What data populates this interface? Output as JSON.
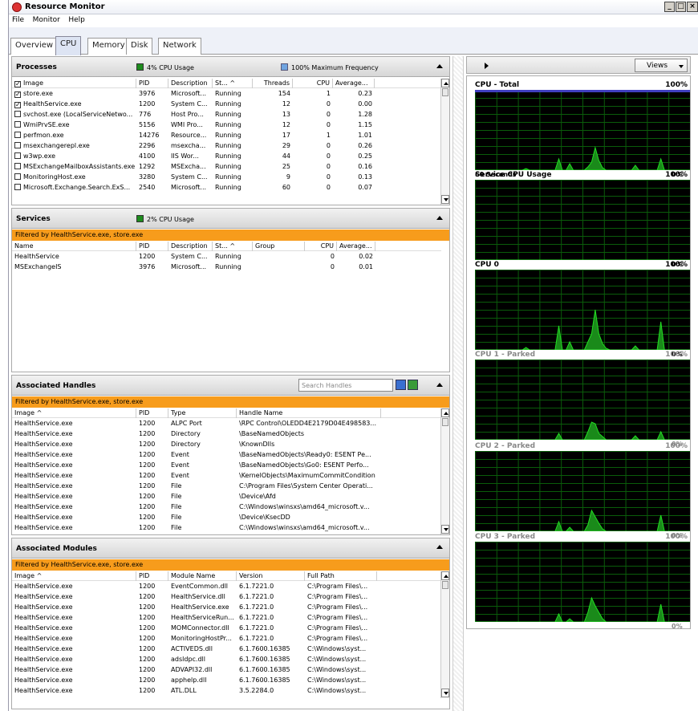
{
  "window": {
    "title": "Resource Monitor"
  },
  "menu": [
    "File",
    "Monitor",
    "Help"
  ],
  "tabs": [
    "Overview",
    "CPU",
    "Memory",
    "Disk",
    "Network"
  ],
  "processes": {
    "title": "Processes",
    "cpu_label": "4% CPU Usage",
    "freq_label": "100% Maximum Frequency",
    "columns": [
      "Image",
      "PID",
      "Description",
      "St... ^",
      "Threads",
      "CPU",
      "Average..."
    ],
    "rows": [
      {
        "checked": true,
        "image": "store.exe",
        "pid": "3976",
        "desc": "Microsoft...",
        "status": "Running",
        "threads": "154",
        "cpu": "1",
        "avg": "0.23"
      },
      {
        "checked": true,
        "image": "HealthService.exe",
        "pid": "1200",
        "desc": "System C...",
        "status": "Running",
        "threads": "12",
        "cpu": "0",
        "avg": "0.00"
      },
      {
        "checked": false,
        "image": "svchost.exe (LocalServiceNetwo...",
        "pid": "776",
        "desc": "Host Pro...",
        "status": "Running",
        "threads": "13",
        "cpu": "0",
        "avg": "1.28"
      },
      {
        "checked": false,
        "image": "WmiPrvSE.exe",
        "pid": "5156",
        "desc": "WMI Pro...",
        "status": "Running",
        "threads": "12",
        "cpu": "0",
        "avg": "1.15"
      },
      {
        "checked": false,
        "image": "perfmon.exe",
        "pid": "14276",
        "desc": "Resource...",
        "status": "Running",
        "threads": "17",
        "cpu": "1",
        "avg": "1.01"
      },
      {
        "checked": false,
        "image": "msexchangerepl.exe",
        "pid": "2296",
        "desc": "msexcha...",
        "status": "Running",
        "threads": "29",
        "cpu": "0",
        "avg": "0.26"
      },
      {
        "checked": false,
        "image": "w3wp.exe",
        "pid": "4100",
        "desc": "IIS Wor...",
        "status": "Running",
        "threads": "44",
        "cpu": "0",
        "avg": "0.25"
      },
      {
        "checked": false,
        "image": "MSExchangeMailboxAssistants.exe",
        "pid": "1292",
        "desc": "MSExcha...",
        "status": "Running",
        "threads": "25",
        "cpu": "0",
        "avg": "0.16"
      },
      {
        "checked": false,
        "image": "MonitoringHost.exe",
        "pid": "3280",
        "desc": "System C...",
        "status": "Running",
        "threads": "9",
        "cpu": "0",
        "avg": "0.13"
      },
      {
        "checked": false,
        "image": "Microsoft.Exchange.Search.ExS...",
        "pid": "2540",
        "desc": "Microsoft...",
        "status": "Running",
        "threads": "60",
        "cpu": "0",
        "avg": "0.07"
      }
    ]
  },
  "services": {
    "title": "Services",
    "cpu_label": "2% CPU Usage",
    "filter": "Filtered by HealthService.exe, store.exe",
    "columns": [
      "Name",
      "PID",
      "Description",
      "St... ^",
      "Group",
      "CPU",
      "Average..."
    ],
    "rows": [
      {
        "name": "HealthService",
        "pid": "1200",
        "desc": "System C...",
        "status": "Running",
        "group": "",
        "cpu": "0",
        "avg": "0.02"
      },
      {
        "name": "MSExchangeIS",
        "pid": "3976",
        "desc": "Microsoft...",
        "status": "Running",
        "group": "",
        "cpu": "0",
        "avg": "0.01"
      }
    ]
  },
  "handles": {
    "title": "Associated Handles",
    "search_placeholder": "Search Handles",
    "filter": "Filtered by HealthService.exe, store.exe",
    "columns": [
      "Image ^",
      "PID",
      "Type",
      "Handle Name"
    ],
    "rows": [
      {
        "image": "HealthService.exe",
        "pid": "1200",
        "type": "ALPC Port",
        "name": "\\RPC Control\\OLEDD4E2179D04E498583..."
      },
      {
        "image": "HealthService.exe",
        "pid": "1200",
        "type": "Directory",
        "name": "\\BaseNamedObjects"
      },
      {
        "image": "HealthService.exe",
        "pid": "1200",
        "type": "Directory",
        "name": "\\KnownDlls"
      },
      {
        "image": "HealthService.exe",
        "pid": "1200",
        "type": "Event",
        "name": "\\BaseNamedObjects\\Ready0: ESENT Pe..."
      },
      {
        "image": "HealthService.exe",
        "pid": "1200",
        "type": "Event",
        "name": "\\BaseNamedObjects\\Go0: ESENT Perfo..."
      },
      {
        "image": "HealthService.exe",
        "pid": "1200",
        "type": "Event",
        "name": "\\KernelObjects\\MaximumCommitCondition"
      },
      {
        "image": "HealthService.exe",
        "pid": "1200",
        "type": "File",
        "name": "C:\\Program Files\\System Center Operati..."
      },
      {
        "image": "HealthService.exe",
        "pid": "1200",
        "type": "File",
        "name": "\\Device\\Afd"
      },
      {
        "image": "HealthService.exe",
        "pid": "1200",
        "type": "File",
        "name": "C:\\Windows\\winsxs\\amd64_microsoft.v..."
      },
      {
        "image": "HealthService.exe",
        "pid": "1200",
        "type": "File",
        "name": "\\Device\\KsecDD"
      },
      {
        "image": "HealthService.exe",
        "pid": "1200",
        "type": "File",
        "name": "C:\\Windows\\winsxs\\amd64_microsoft.v..."
      }
    ]
  },
  "modules": {
    "title": "Associated Modules",
    "filter": "Filtered by HealthService.exe, store.exe",
    "columns": [
      "Image ^",
      "PID",
      "Module Name",
      "Version",
      "Full Path"
    ],
    "rows": [
      {
        "image": "HealthService.exe",
        "pid": "1200",
        "module": "EventCommon.dll",
        "version": "6.1.7221.0",
        "path": "C:\\Program Files\\..."
      },
      {
        "image": "HealthService.exe",
        "pid": "1200",
        "module": "HealthService.dll",
        "version": "6.1.7221.0",
        "path": "C:\\Program Files\\..."
      },
      {
        "image": "HealthService.exe",
        "pid": "1200",
        "module": "HealthService.exe",
        "version": "6.1.7221.0",
        "path": "C:\\Program Files\\..."
      },
      {
        "image": "HealthService.exe",
        "pid": "1200",
        "module": "HealthServiceRun...",
        "version": "6.1.7221.0",
        "path": "C:\\Program Files\\..."
      },
      {
        "image": "HealthService.exe",
        "pid": "1200",
        "module": "MOMConnector.dll",
        "version": "6.1.7221.0",
        "path": "C:\\Program Files\\..."
      },
      {
        "image": "HealthService.exe",
        "pid": "1200",
        "module": "MonitoringHostPr...",
        "version": "6.1.7221.0",
        "path": "C:\\Program Files\\..."
      },
      {
        "image": "HealthService.exe",
        "pid": "1200",
        "module": "ACTIVEDS.dll",
        "version": "6.1.7600.16385",
        "path": "C:\\Windows\\syst..."
      },
      {
        "image": "HealthService.exe",
        "pid": "1200",
        "module": "adsldpc.dll",
        "version": "6.1.7600.16385",
        "path": "C:\\Windows\\syst..."
      },
      {
        "image": "HealthService.exe",
        "pid": "1200",
        "module": "ADVAPI32.dll",
        "version": "6.1.7600.16385",
        "path": "C:\\Windows\\syst..."
      },
      {
        "image": "HealthService.exe",
        "pid": "1200",
        "module": "apphelp.dll",
        "version": "6.1.7600.16385",
        "path": "C:\\Windows\\syst..."
      },
      {
        "image": "HealthService.exe",
        "pid": "1200",
        "module": "ATL.DLL",
        "version": "3.5.2284.0",
        "path": "C:\\Windows\\syst..."
      }
    ]
  },
  "right": {
    "views_label": "Views",
    "graphs": [
      {
        "title": "CPU - Total",
        "max": "100%",
        "min": "0%",
        "footer": "60 Seconds",
        "parked": false,
        "values": [
          0,
          0,
          0,
          0,
          0,
          0,
          0,
          0,
          0,
          0,
          0,
          0,
          0,
          0,
          2,
          0,
          0,
          0,
          0,
          0,
          0,
          0,
          0,
          14,
          0,
          0,
          8,
          0,
          0,
          0,
          0,
          4,
          10,
          28,
          12,
          3,
          0,
          0,
          0,
          0,
          0,
          0,
          0,
          0,
          6,
          0,
          0,
          0,
          0,
          0,
          0,
          14,
          0,
          0,
          0,
          0,
          0,
          0,
          0,
          0
        ],
        "top_band": true
      },
      {
        "title": "Service CPU Usage",
        "max": "100%",
        "min": "0%",
        "parked": false,
        "values": [
          0,
          0,
          0,
          0,
          0,
          0,
          0,
          0,
          0,
          0,
          0,
          0,
          0,
          0,
          0,
          0,
          0,
          0,
          0,
          0,
          0,
          0,
          0,
          0,
          0,
          0,
          0,
          0,
          0,
          0,
          0,
          0,
          0,
          0,
          0,
          0,
          0,
          0,
          0,
          0,
          0,
          0,
          0,
          0,
          0,
          0,
          0,
          0,
          0,
          0,
          0,
          0,
          0,
          0,
          0,
          0,
          0,
          0,
          0,
          0
        ]
      },
      {
        "title": "CPU 0",
        "max": "100%",
        "min": "0%",
        "parked": false,
        "values": [
          0,
          0,
          0,
          0,
          0,
          0,
          0,
          0,
          0,
          0,
          0,
          0,
          0,
          0,
          3,
          0,
          0,
          0,
          0,
          0,
          0,
          0,
          0,
          30,
          0,
          0,
          10,
          0,
          0,
          0,
          0,
          10,
          20,
          50,
          20,
          8,
          2,
          0,
          0,
          0,
          0,
          0,
          0,
          0,
          5,
          0,
          0,
          0,
          0,
          0,
          0,
          35,
          0,
          0,
          0,
          0,
          0,
          0,
          0,
          0
        ]
      },
      {
        "title": "CPU 1 - Parked",
        "max": "100%",
        "min": "0%",
        "parked": true,
        "values": [
          0,
          0,
          0,
          0,
          0,
          0,
          0,
          0,
          0,
          0,
          0,
          0,
          0,
          0,
          0,
          0,
          0,
          0,
          0,
          0,
          0,
          0,
          0,
          8,
          0,
          0,
          0,
          0,
          0,
          0,
          0,
          10,
          22,
          20,
          8,
          4,
          0,
          0,
          0,
          0,
          0,
          0,
          0,
          0,
          5,
          0,
          0,
          0,
          0,
          0,
          0,
          10,
          0,
          0,
          0,
          0,
          0,
          0,
          0,
          0
        ]
      },
      {
        "title": "CPU 2 - Parked",
        "max": "100%",
        "min": "0%",
        "parked": true,
        "values": [
          0,
          0,
          0,
          0,
          0,
          0,
          0,
          0,
          0,
          0,
          0,
          0,
          0,
          0,
          0,
          0,
          0,
          0,
          0,
          0,
          0,
          0,
          0,
          12,
          0,
          0,
          5,
          0,
          0,
          0,
          0,
          8,
          26,
          18,
          10,
          3,
          0,
          0,
          0,
          0,
          0,
          0,
          0,
          0,
          0,
          0,
          0,
          0,
          0,
          0,
          0,
          20,
          0,
          0,
          0,
          0,
          0,
          0,
          0,
          0
        ]
      },
      {
        "title": "CPU 3 - Parked",
        "max": "100%",
        "min": "0%",
        "parked": true,
        "values": [
          0,
          0,
          0,
          0,
          0,
          0,
          0,
          0,
          0,
          0,
          0,
          0,
          0,
          0,
          0,
          0,
          0,
          0,
          0,
          0,
          0,
          0,
          0,
          10,
          0,
          0,
          4,
          0,
          0,
          0,
          0,
          12,
          30,
          20,
          12,
          4,
          0,
          0,
          0,
          0,
          0,
          0,
          0,
          0,
          0,
          0,
          0,
          0,
          0,
          0,
          0,
          22,
          0,
          0,
          0,
          0,
          0,
          0,
          0,
          0
        ]
      }
    ]
  },
  "colors": {
    "filter": "#f79c1c",
    "cpu_square": "#1e8c1e",
    "freq_square": "#6fa4e0",
    "graph_line": "#22dd22",
    "graph_bg": "#000000",
    "band": "#4040c0"
  }
}
